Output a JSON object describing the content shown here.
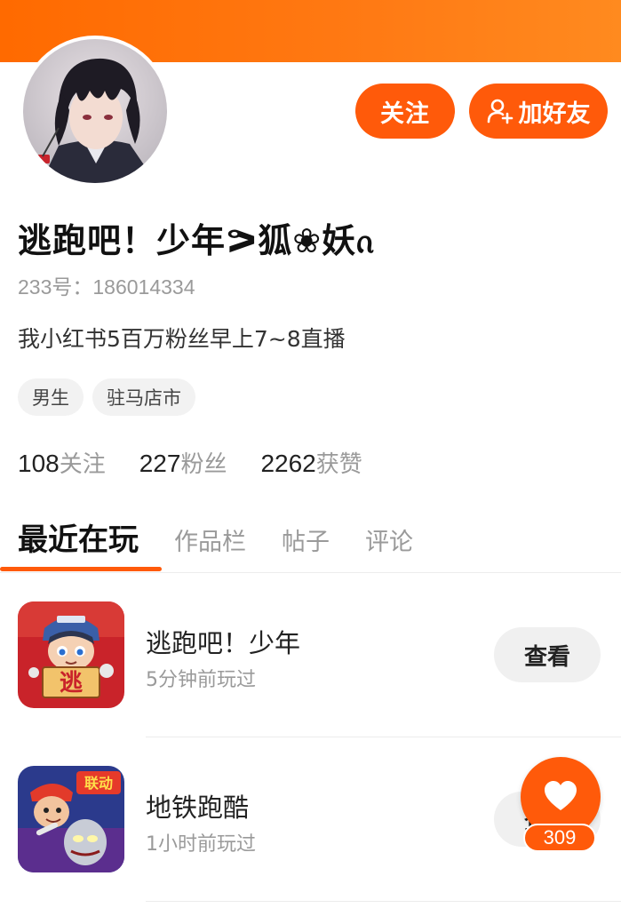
{
  "profile": {
    "name": "逃跑吧！少年ᕗ狐❀妖ᦵ",
    "id_text": "233号：186014334",
    "bio": "我小红书5百万粉丝早上7~8直播",
    "tags": [
      "男生",
      "驻马店市"
    ]
  },
  "actions": {
    "follow_label": "关注",
    "add_friend_label": "加好友"
  },
  "stats": [
    {
      "num": "108",
      "label": "关注"
    },
    {
      "num": "227",
      "label": "粉丝"
    },
    {
      "num": "2262",
      "label": "获赞"
    }
  ],
  "tabs": [
    {
      "label": "最近在玩",
      "active": true
    },
    {
      "label": "作品栏",
      "active": false
    },
    {
      "label": "帖子",
      "active": false
    },
    {
      "label": "评论",
      "active": false
    }
  ],
  "games": [
    {
      "name": "逃跑吧！少年",
      "time": "5分钟前玩过",
      "view_label": "查看",
      "icon": "escape-game-icon"
    },
    {
      "name": "地铁跑酷",
      "time": "1小时前玩过",
      "view_label": "查看",
      "icon": "subway-surfers-icon"
    }
  ],
  "like": {
    "count": "309",
    "icon": "heart-icon"
  },
  "colors": {
    "accent": "#ff5a0a",
    "banner": "#ff7a14"
  }
}
